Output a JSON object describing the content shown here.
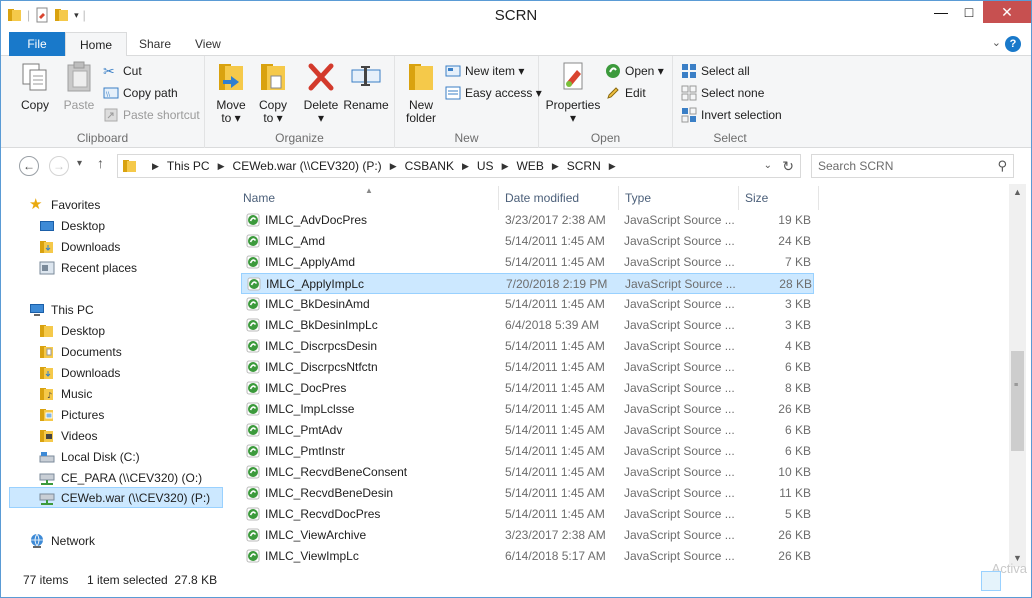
{
  "window": {
    "title": "SCRN"
  },
  "window_controls": {
    "minimize": "—",
    "maximize": "□",
    "close": "✕"
  },
  "ribbon_tabs": [
    "File",
    "Home",
    "Share",
    "View"
  ],
  "ribbon": {
    "clipboard": {
      "label": "Clipboard",
      "copy": "Copy",
      "paste": "Paste",
      "cut": "Cut",
      "copy_path": "Copy path",
      "paste_shortcut": "Paste shortcut"
    },
    "organize": {
      "label": "Organize",
      "move_to": "Move",
      "move_to2": "to ▾",
      "copy_to": "Copy",
      "copy_to2": "to ▾",
      "delete": "Delete",
      "delete2": "▾",
      "rename": "Rename"
    },
    "new": {
      "label": "New",
      "new_folder": "New",
      "new_folder2": "folder",
      "new_item": "New item ▾",
      "easy_access": "Easy access ▾"
    },
    "open": {
      "label": "Open",
      "properties": "Properties",
      "properties2": "▾",
      "open": "Open ▾",
      "edit": "Edit"
    },
    "select": {
      "label": "Select",
      "select_all": "Select all",
      "select_none": "Select none",
      "invert_selection": "Invert selection"
    }
  },
  "navigation": {
    "back": "←",
    "forward": "→",
    "recent": "▾",
    "up": "↑",
    "breadcrumb": [
      "This PC",
      "CEWeb.war (\\\\CEV320) (P:)",
      "CSBANK",
      "US",
      "WEB",
      "SCRN"
    ],
    "search_placeholder": "Search SCRN"
  },
  "nav_pane": {
    "favorites": "Favorites",
    "desktop": "Desktop",
    "downloads": "Downloads",
    "recent_places": "Recent places",
    "this_pc": "This PC",
    "pc_desktop": "Desktop",
    "documents": "Documents",
    "pc_downloads": "Downloads",
    "music": "Music",
    "pictures": "Pictures",
    "videos": "Videos",
    "local_disk": "Local Disk (C:)",
    "ce_para": "CE_PARA (\\\\CEV320) (O:)",
    "ceweb": "CEWeb.war (\\\\CEV320) (P:)",
    "network": "Network"
  },
  "columns": {
    "name": "Name",
    "date": "Date modified",
    "type": "Type",
    "size": "Size"
  },
  "files": [
    {
      "name": "IMLC_AdvDocPres",
      "date": "3/23/2017 2:38 AM",
      "type": "JavaScript Source ...",
      "size": "19 KB"
    },
    {
      "name": "IMLC_Amd",
      "date": "5/14/2011 1:45 AM",
      "type": "JavaScript Source ...",
      "size": "24 KB"
    },
    {
      "name": "IMLC_ApplyAmd",
      "date": "5/14/2011 1:45 AM",
      "type": "JavaScript Source ...",
      "size": "7 KB"
    },
    {
      "name": "IMLC_ApplyImpLc",
      "date": "7/20/2018 2:19 PM",
      "type": "JavaScript Source ...",
      "size": "28 KB"
    },
    {
      "name": "IMLC_BkDesinAmd",
      "date": "5/14/2011 1:45 AM",
      "type": "JavaScript Source ...",
      "size": "3 KB"
    },
    {
      "name": "IMLC_BkDesinImpLc",
      "date": "6/4/2018 5:39 AM",
      "type": "JavaScript Source ...",
      "size": "3 KB"
    },
    {
      "name": "IMLC_DiscrpcsDesin",
      "date": "5/14/2011 1:45 AM",
      "type": "JavaScript Source ...",
      "size": "4 KB"
    },
    {
      "name": "IMLC_DiscrpcsNtfctn",
      "date": "5/14/2011 1:45 AM",
      "type": "JavaScript Source ...",
      "size": "6 KB"
    },
    {
      "name": "IMLC_DocPres",
      "date": "5/14/2011 1:45 AM",
      "type": "JavaScript Source ...",
      "size": "8 KB"
    },
    {
      "name": "IMLC_ImpLclsse",
      "date": "5/14/2011 1:45 AM",
      "type": "JavaScript Source ...",
      "size": "26 KB"
    },
    {
      "name": "IMLC_PmtAdv",
      "date": "5/14/2011 1:45 AM",
      "type": "JavaScript Source ...",
      "size": "6 KB"
    },
    {
      "name": "IMLC_PmtInstr",
      "date": "5/14/2011 1:45 AM",
      "type": "JavaScript Source ...",
      "size": "6 KB"
    },
    {
      "name": "IMLC_RecvdBeneConsent",
      "date": "5/14/2011 1:45 AM",
      "type": "JavaScript Source ...",
      "size": "10 KB"
    },
    {
      "name": "IMLC_RecvdBeneDesin",
      "date": "5/14/2011 1:45 AM",
      "type": "JavaScript Source ...",
      "size": "11 KB"
    },
    {
      "name": "IMLC_RecvdDocPres",
      "date": "5/14/2011 1:45 AM",
      "type": "JavaScript Source ...",
      "size": "5 KB"
    },
    {
      "name": "IMLC_ViewArchive",
      "date": "3/23/2017 2:38 AM",
      "type": "JavaScript Source ...",
      "size": "26 KB"
    },
    {
      "name": "IMLC_ViewImpLc",
      "date": "6/14/2018 5:17 AM",
      "type": "JavaScript Source ...",
      "size": "26 KB"
    }
  ],
  "selected_file": "IMLC_ApplyImpLc",
  "status": {
    "count": "77 items",
    "selection": "1 item selected  27.8 KB"
  },
  "watermark": "Activa",
  "colors": {
    "accent": "#1979ca",
    "selection": "#cce8ff",
    "selection_border": "#99d1ff",
    "file_icon": "#3c9a3c"
  }
}
